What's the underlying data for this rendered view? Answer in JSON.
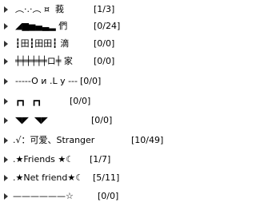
{
  "groups": [
    {
      "name": "︵·.·︵ ¤  莪",
      "count": "[1/3]"
    },
    {
      "name": "◢▆▅▄▃▂ 們",
      "count": "[0/24]"
    },
    {
      "name": "┇田┇田田┇ 滴",
      "count": "[0/0]"
    },
    {
      "name": "╪╪╪╪╪╪ロ╪ 家",
      "count": "[0/0]"
    },
    {
      "name": "-----O и .L у ---",
      "count": "[0/0]"
    },
    {
      "name": "┏┓  ┏┓",
      "count": "[0/0]"
    },
    {
      "name": "◥◤  ◥◤",
      "count": "[0/0]"
    },
    {
      "name": ".√：可爱、Stranger",
      "count": "[10/49]"
    },
    {
      "name": ".★Friends ★☾",
      "count": "[1/7]"
    },
    {
      "name": ".★Net friend★☾",
      "count": "[5/11]"
    },
    {
      "name": "——————☆",
      "count": "[0/0]"
    }
  ],
  "icons": {
    "expand": "triangle-right"
  },
  "colors": {
    "arrow": "#333333",
    "text": "#000000",
    "background": "#ffffff"
  }
}
